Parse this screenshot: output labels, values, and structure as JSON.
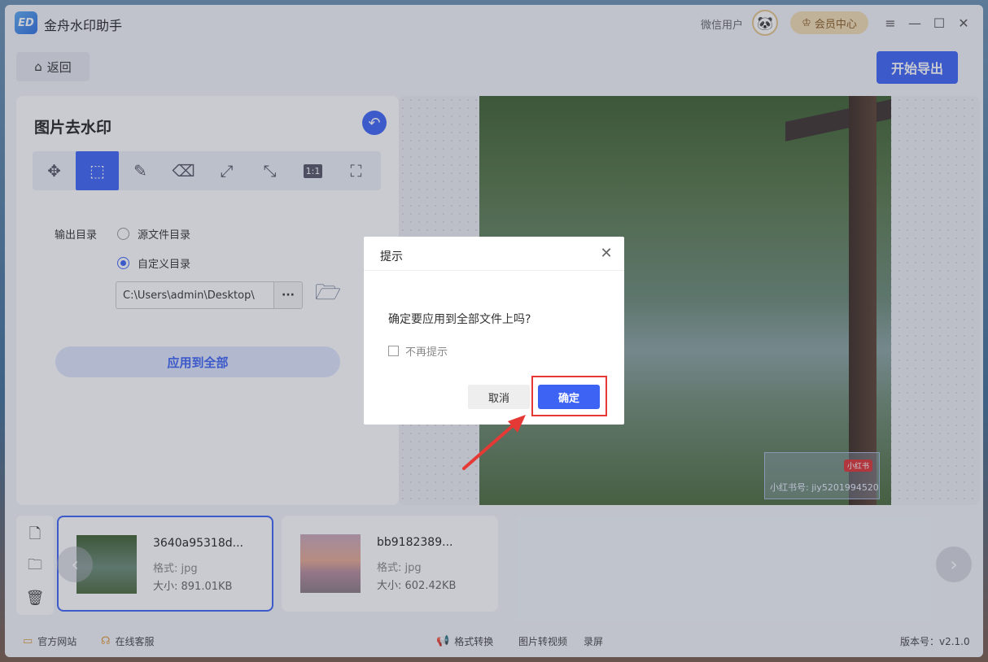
{
  "titlebar": {
    "logo_text": "ED",
    "app_title": "金舟水印助手",
    "user_name": "微信用户",
    "vip_label": "会员中心",
    "min": "—",
    "max": "☐",
    "close": "✕",
    "menu": "≡"
  },
  "toolbar": {
    "back_label": "返回",
    "export_label": "开始导出"
  },
  "panel": {
    "title": "图片去水印",
    "output_label": "输出目录",
    "option_source": "源文件目录",
    "option_custom": "自定义目录",
    "path_value": "C:\\Users\\admin\\Desktop\\",
    "more": "···",
    "apply_all": "应用到全部"
  },
  "tools": [
    "move-icon",
    "select-icon",
    "brush-icon",
    "eraser-icon",
    "expand-icon",
    "shrink-icon",
    "ratio-icon",
    "fit-icon"
  ],
  "preview": {
    "watermark_tag": "小红书",
    "watermark_text": "小红书号: jiy5201994520"
  },
  "files": [
    {
      "name": "3640a95318d...",
      "format": "格式: jpg",
      "size": "大小: 891.01KB"
    },
    {
      "name": "bb9182389...",
      "format": "格式: jpg",
      "size": "大小: 602.42KB"
    }
  ],
  "footer": {
    "official_site": "官方网站",
    "support": "在线客服",
    "format_convert": "格式转换",
    "img_to_video": "图片转视频",
    "record": "录屏",
    "version": "版本号：v2.1.0"
  },
  "dialog": {
    "title": "提示",
    "message": "确定要应用到全部文件上吗?",
    "dont_show": "不再提示",
    "cancel": "取消",
    "ok": "确定"
  },
  "colors": {
    "accent": "#3d63f5",
    "highlight": "#e53935"
  }
}
